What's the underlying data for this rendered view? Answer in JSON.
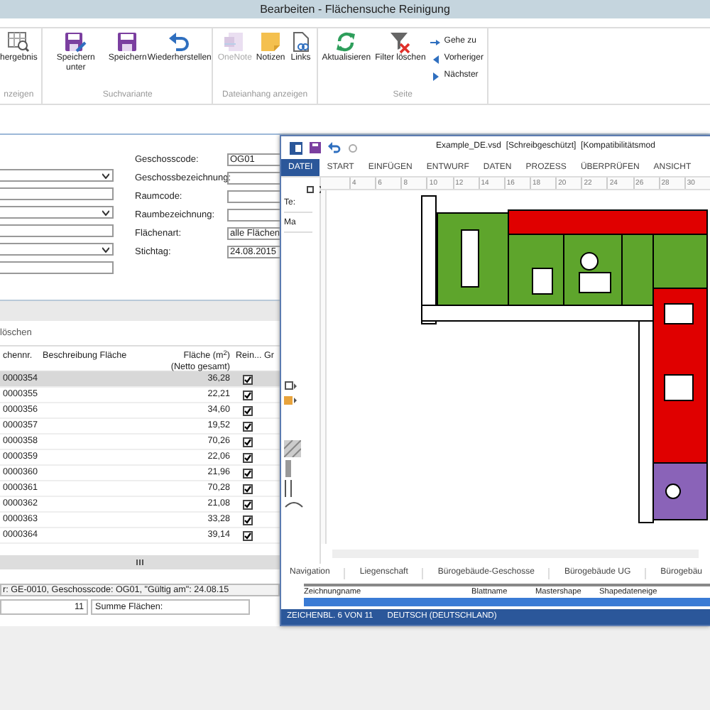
{
  "window": {
    "title": "Bearbeiten - Flächensuche Reinigung"
  },
  "ribbon": {
    "groups": [
      {
        "label": "nzeigen",
        "buttons": [
          {
            "label": "hergebnis",
            "kind": "grid-search",
            "disabled": false
          }
        ]
      },
      {
        "label": "Suchvariante",
        "buttons": [
          {
            "label": "Speichern unter",
            "kind": "save-as",
            "disabled": false
          },
          {
            "label": "Speichern",
            "kind": "save",
            "disabled": false
          },
          {
            "label": "Wiederherstellen",
            "kind": "undo",
            "disabled": false
          }
        ]
      },
      {
        "label": "Dateianhang anzeigen",
        "buttons": [
          {
            "label": "OneNote",
            "kind": "onenote",
            "disabled": true
          },
          {
            "label": "Notizen",
            "kind": "note",
            "disabled": false
          },
          {
            "label": "Links",
            "kind": "link",
            "disabled": false
          }
        ]
      },
      {
        "label": "Seite",
        "buttons": [
          {
            "label": "Aktualisieren",
            "kind": "refresh",
            "disabled": false
          },
          {
            "label": "Filter löschen",
            "kind": "filter-clear",
            "disabled": false
          }
        ],
        "small_buttons": [
          {
            "label": "Gehe zu",
            "kind": "goto"
          },
          {
            "label": "Vorheriger",
            "kind": "prev"
          },
          {
            "label": "Nächster",
            "kind": "next"
          }
        ]
      }
    ]
  },
  "form": {
    "left_fields": [
      {
        "kind": "select"
      },
      {
        "kind": "text"
      },
      {
        "kind": "select"
      },
      {
        "kind": "text"
      },
      {
        "kind": "select"
      },
      {
        "kind": "text"
      }
    ],
    "fields": [
      {
        "label": "Geschosscode:",
        "value": "OG01"
      },
      {
        "label": "Geschossbezeichnung:"
      },
      {
        "label": "Raumcode:"
      },
      {
        "label": "Raumbezeichnung:"
      },
      {
        "label": "Flächenart:",
        "value": "alle Flächen"
      },
      {
        "label": "Stichtag:",
        "value": "24.08.2015"
      }
    ]
  },
  "toolbar": {
    "label": "löschen"
  },
  "grid": {
    "columns": [
      {
        "label": "chennr."
      },
      {
        "label": "Beschreibung Fläche"
      },
      {
        "label": "Fläche (m$^{2}$)",
        "sublabel": "(Netto gesamt)"
      },
      {
        "label": "Rein..."
      },
      {
        "label": "Gr"
      }
    ],
    "rows": [
      {
        "number": "0000354",
        "area": "36,28",
        "clean": true,
        "selected": true
      },
      {
        "number": "0000355",
        "area": "22,21",
        "clean": true,
        "selected": false
      },
      {
        "number": "0000356",
        "area": "34,60",
        "clean": true,
        "selected": false
      },
      {
        "number": "0000357",
        "area": "19,52",
        "clean": true,
        "selected": false
      },
      {
        "number": "0000358",
        "area": "70,26",
        "clean": true,
        "selected": false
      },
      {
        "number": "0000359",
        "area": "22,06",
        "clean": true,
        "selected": false
      },
      {
        "number": "0000360",
        "area": "21,96",
        "clean": true,
        "selected": false
      },
      {
        "number": "0000361",
        "area": "70,28",
        "clean": true,
        "selected": false
      },
      {
        "number": "0000362",
        "area": "21,08",
        "clean": true,
        "selected": false
      },
      {
        "number": "0000363",
        "area": "33,28",
        "clean": true,
        "selected": false
      },
      {
        "number": "0000364",
        "area": "39,14",
        "clean": true,
        "selected": false
      }
    ]
  },
  "status": {
    "filter": "r: GE-0010, Geschosscode: OG01, \"Gültig am\": 24.08.15",
    "count": "11",
    "sum_label": "Summe Flächen:"
  },
  "visio": {
    "title": "Example_DE.vsd  [Schreibgeschützt]  [Kompatibilitätsmod",
    "tabs": [
      {
        "label": "DATEI",
        "selected": true
      },
      {
        "label": "START",
        "selected": false
      },
      {
        "label": "EINFÜGEN",
        "selected": false
      },
      {
        "label": "ENTWURF",
        "selected": false
      },
      {
        "label": "DATEN",
        "selected": false
      },
      {
        "label": "PROZESS",
        "selected": false
      },
      {
        "label": "ÜBERPRÜFEN",
        "selected": false
      },
      {
        "label": "ANSICHT",
        "selected": false
      }
    ],
    "panel_items": [
      "Te:",
      "Ma"
    ],
    "ruler": [
      "4",
      "6",
      "8",
      "10",
      "12",
      "14",
      "16",
      "18",
      "20",
      "22",
      "24",
      "26",
      "28",
      "30"
    ],
    "page_tabs": [
      "Navigation",
      "Liegenschaft",
      "Bürogebäude-Geschosse",
      "Bürogebäude UG",
      "Bürogebäu"
    ],
    "shape_data": {
      "columns": [
        "Zeichnungname",
        "Blattname",
        "Mastershape",
        "Shapedateneige"
      ]
    },
    "status": [
      "ZEICHENBL. 6 VON 11",
      "DEUTSCH (DEUTSCHLAND)"
    ]
  }
}
